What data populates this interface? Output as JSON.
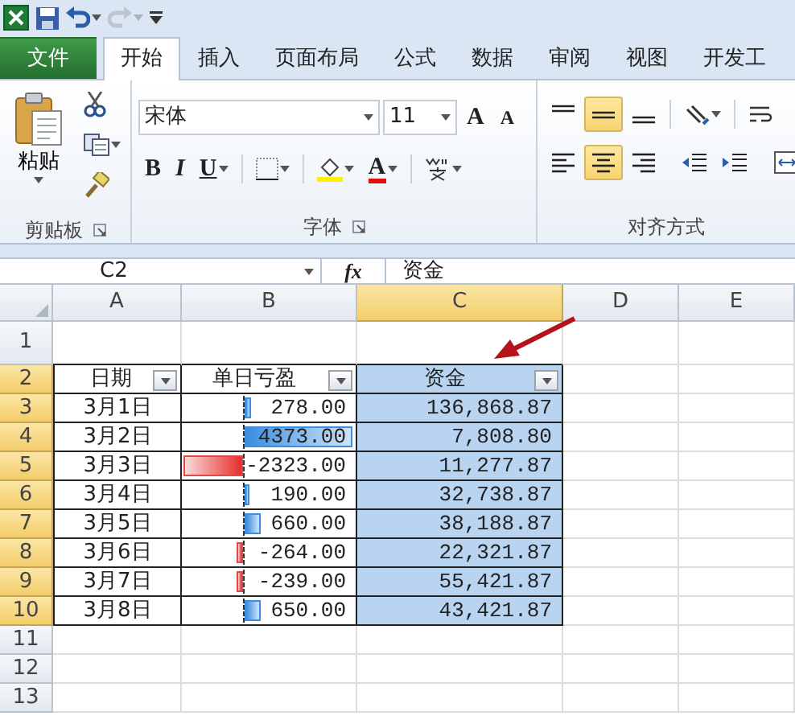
{
  "quick_access": {
    "buttons": [
      {
        "kind": "app",
        "disabled": false
      },
      {
        "kind": "save",
        "disabled": false
      },
      {
        "kind": "undo",
        "disabled": false
      },
      {
        "kind": "redo",
        "disabled": true
      },
      {
        "kind": "customize",
        "disabled": false
      }
    ]
  },
  "tabs": [
    {
      "label": "文件",
      "kind": "file",
      "selected": false
    },
    {
      "label": "开始",
      "kind": "tab",
      "selected": true
    },
    {
      "label": "插入",
      "kind": "tab",
      "selected": false
    },
    {
      "label": "页面布局",
      "kind": "tab",
      "selected": false
    },
    {
      "label": "公式",
      "kind": "tab",
      "selected": false
    },
    {
      "label": "数据",
      "kind": "tab",
      "selected": false
    },
    {
      "label": "审阅",
      "kind": "tab",
      "selected": false
    },
    {
      "label": "视图",
      "kind": "tab",
      "selected": false
    },
    {
      "label": "开发工",
      "kind": "tab",
      "selected": false
    }
  ],
  "ribbon": {
    "clipboard": {
      "title": "剪贴板",
      "paste_label": "粘贴"
    },
    "font": {
      "title": "字体",
      "font_name": "宋体",
      "font_size": "11",
      "grow_label": "A",
      "shrink_label": "A",
      "bold_label": "B",
      "italic_label": "I",
      "underline_label": "U",
      "font_color_label": "A"
    },
    "alignment": {
      "title": "对齐方式",
      "vertical": [
        {
          "kind": "top",
          "selected": false
        },
        {
          "kind": "middle",
          "selected": true
        },
        {
          "kind": "bottom",
          "selected": false
        }
      ],
      "horizontal": [
        {
          "kind": "left",
          "selected": false
        },
        {
          "kind": "center",
          "selected": true
        },
        {
          "kind": "right",
          "selected": false
        }
      ]
    }
  },
  "formula_bar": {
    "name_box": "C2",
    "function_label": "fx",
    "formula": "资金"
  },
  "sheet": {
    "columns": [
      {
        "label": "A",
        "selected": false
      },
      {
        "label": "B",
        "selected": false
      },
      {
        "label": "C",
        "selected": true
      },
      {
        "label": "D",
        "selected": false
      },
      {
        "label": "E",
        "selected": false
      }
    ],
    "rows": [
      {
        "number": "1",
        "kind": "empty",
        "selected": false
      },
      {
        "number": "2",
        "kind": "header",
        "selected": true,
        "date": "日期",
        "profit": {
          "text": "单日亏盈"
        },
        "capital": "资金"
      },
      {
        "number": "3",
        "kind": "data",
        "selected": true,
        "date": "3月1日",
        "profit": {
          "text": "278.00",
          "kind": "gain",
          "level": 0.064
        },
        "capital": "136,868.87"
      },
      {
        "number": "4",
        "kind": "data",
        "selected": true,
        "date": "3月2日",
        "profit": {
          "text": "4373.00",
          "kind": "gain",
          "level": 1
        },
        "capital": "7,808.80"
      },
      {
        "number": "5",
        "kind": "data",
        "selected": true,
        "date": "3月3日",
        "profit": {
          "text": "-2323.00",
          "kind": "loss",
          "level": 1
        },
        "capital": "11,277.87"
      },
      {
        "number": "6",
        "kind": "data",
        "selected": true,
        "date": "3月4日",
        "profit": {
          "text": "190.00",
          "kind": "gain",
          "level": 0.043
        },
        "capital": "32,738.87"
      },
      {
        "number": "7",
        "kind": "data",
        "selected": true,
        "date": "3月5日",
        "profit": {
          "text": "660.00",
          "kind": "gain",
          "level": 0.151
        },
        "capital": "38,188.87"
      },
      {
        "number": "8",
        "kind": "data",
        "selected": true,
        "date": "3月6日",
        "profit": {
          "text": "-264.00",
          "kind": "loss",
          "level": 0.114
        },
        "capital": "22,321.87"
      },
      {
        "number": "9",
        "kind": "data",
        "selected": true,
        "date": "3月7日",
        "profit": {
          "text": "-239.00",
          "kind": "loss",
          "level": 0.103
        },
        "capital": "55,421.87"
      },
      {
        "number": "10",
        "kind": "data",
        "selected": true,
        "date": "3月8日",
        "profit": {
          "text": "650.00",
          "kind": "gain",
          "level": 0.149
        },
        "capital": "43,421.87"
      },
      {
        "number": "11",
        "kind": "empty",
        "selected": false
      },
      {
        "number": "12",
        "kind": "empty",
        "selected": false
      },
      {
        "number": "13",
        "kind": "empty",
        "selected": false
      }
    ]
  }
}
